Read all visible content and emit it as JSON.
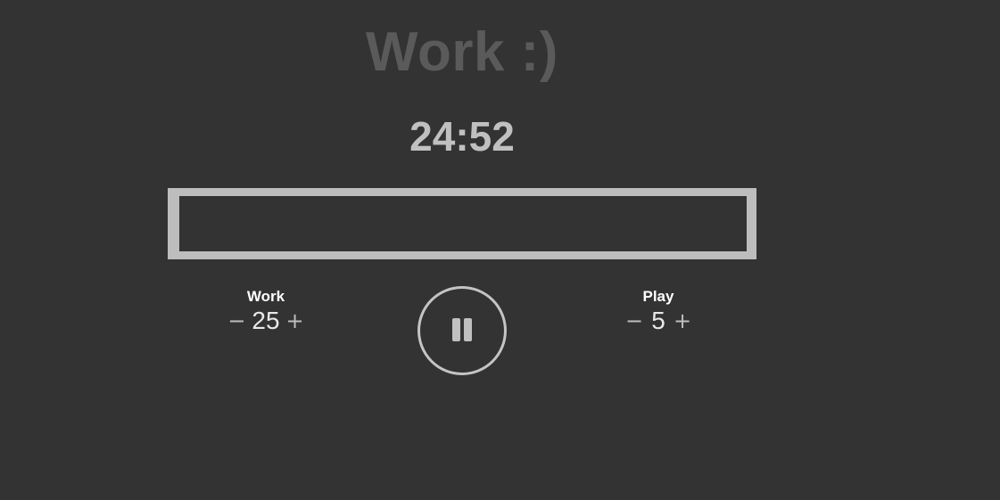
{
  "header": {
    "mode_title": "Work :)"
  },
  "timer": {
    "display": "24:52"
  },
  "progress": {
    "fraction_complete": 0.0
  },
  "settings": {
    "work": {
      "label": "Work",
      "value": "25",
      "decrement_label": "−",
      "increment_label": "+"
    },
    "play": {
      "label": "Play",
      "value": "5",
      "decrement_label": "−",
      "increment_label": "+"
    }
  },
  "controls": {
    "play_pause_icon": "pause-icon"
  },
  "colors": {
    "background": "#333333",
    "title": "#5a5a5a",
    "timer": "#c0c0c0",
    "progress_border": "#bdbdbd",
    "label": "#ffffff"
  }
}
